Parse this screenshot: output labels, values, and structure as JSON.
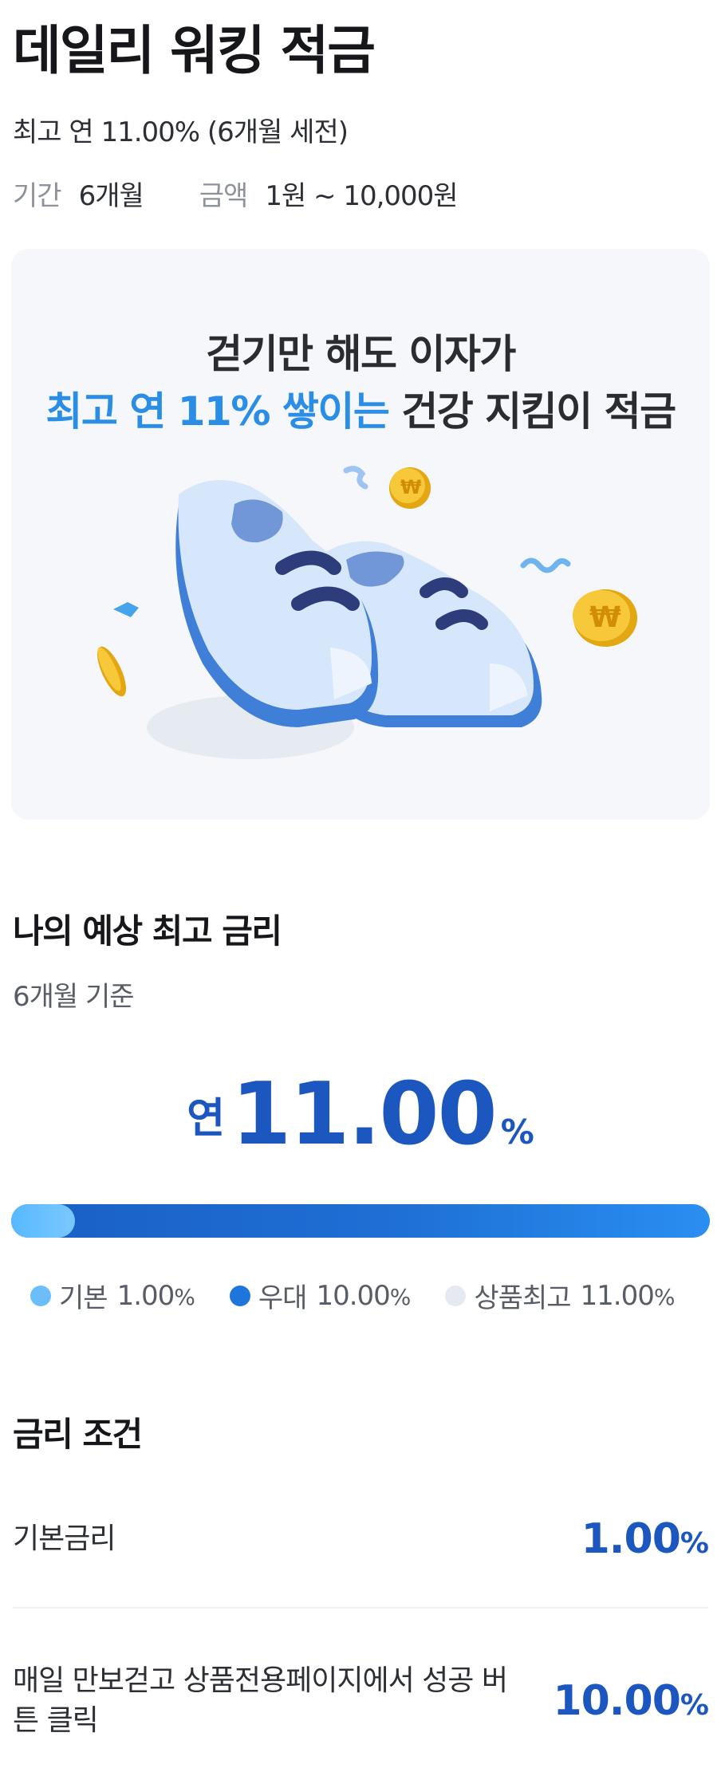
{
  "header": {
    "title": "데일리 워킹 적금",
    "subtitle": "최고 연 11.00% (6개월 세전)",
    "period_key": "기간",
    "period_value": "6개월",
    "amount_key": "금액",
    "amount_value": "1원 ~ 10,000원"
  },
  "banner": {
    "line1": "걷기만 해도 이자가",
    "line2_highlight": "최고 연 11% 쌓이는",
    "line2_rest": "건강 지킴이 적금",
    "illustration": "sneakers-with-coins"
  },
  "expected_rate": {
    "heading": "나의 예상 최고 금리",
    "basis": "6개월 기준",
    "prefix": "연",
    "value": "11.00",
    "unit": "%",
    "bar": {
      "base_fraction": 0.0909,
      "total_fraction": 1.0
    }
  },
  "legend": [
    {
      "label": "기본",
      "value": "1.00",
      "unit": "%",
      "color": "#6cbef9"
    },
    {
      "label": "우대",
      "value": "10.00",
      "unit": "%",
      "color": "#1e76dc"
    },
    {
      "label": "상품최고",
      "value": "11.00",
      "unit": "%",
      "color": "#e6e9ef"
    }
  ],
  "conditions": {
    "heading": "금리 조건",
    "rows": [
      {
        "label": "기본금리",
        "rate": "1.00",
        "unit": "%"
      },
      {
        "label": "매일 만보걷고 상품전용페이지에서 성공 버튼 클릭",
        "rate": "10.00",
        "unit": "%"
      }
    ]
  },
  "colors": {
    "accent": "#1c57c0",
    "highlight": "#2a8ee6",
    "banner_bg": "#f5f7fa"
  }
}
